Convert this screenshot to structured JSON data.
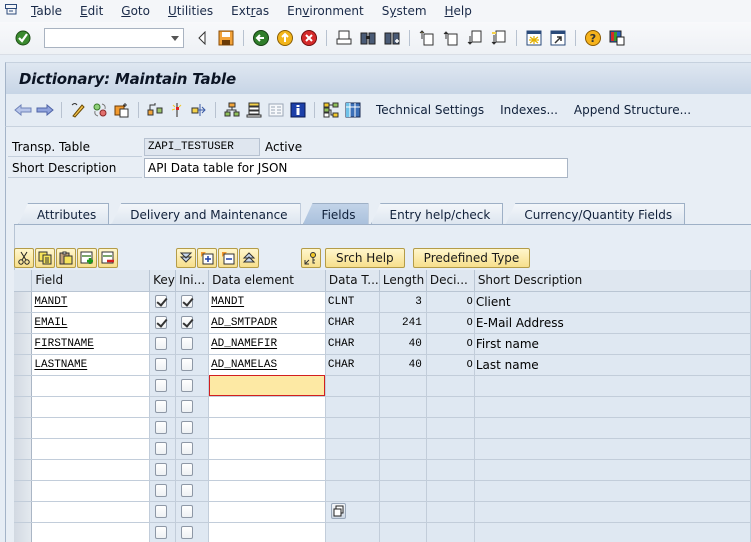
{
  "menubar": {
    "system_icon": "system-menu-icon",
    "items": [
      {
        "label": "Table",
        "mnemonic_index": 0
      },
      {
        "label": "Edit",
        "mnemonic_index": 0
      },
      {
        "label": "Goto",
        "mnemonic_index": 0
      },
      {
        "label": "Utilities",
        "mnemonic_index": 0
      },
      {
        "label": "Extras",
        "mnemonic_index": 3
      },
      {
        "label": "Environment",
        "mnemonic_index": 2
      },
      {
        "label": "System",
        "mnemonic_index": 1
      },
      {
        "label": "Help",
        "mnemonic_index": 0
      }
    ]
  },
  "standard_toolbar": {
    "command_field": {
      "value": "",
      "placeholder": ""
    },
    "icons": [
      "enter-icon",
      "back-arrow-icon",
      "save-icon",
      "back-icon",
      "exit-icon",
      "cancel-icon",
      "print-icon",
      "find-icon",
      "find-next-icon",
      "first-page-icon",
      "previous-page-icon",
      "next-page-icon",
      "last-page-icon",
      "new-session-icon",
      "shortcut-icon",
      "help-icon",
      "layout-menu-icon"
    ]
  },
  "title": "Dictionary: Maintain Table",
  "app_toolbar": {
    "icons": [
      "back-arrow-icon",
      "forward-arrow-icon",
      "display-change-icon",
      "other-object-icon",
      "activate-icon",
      "where-used-icon",
      "object-list-icon",
      "navigation-window-icon",
      "hierarchy-icon",
      "worklist-icon",
      "documentation-icon",
      "info-icon",
      "structure-graphic-icon",
      "table-icon"
    ],
    "buttons": [
      "Technical Settings",
      "Indexes...",
      "Append Structure..."
    ]
  },
  "header": {
    "table_label": "Transp. Table",
    "table_value": "ZAPI_TESTUSER",
    "status": "Active",
    "desc_label": "Short Description",
    "desc_value": "API Data table for JSON"
  },
  "tabs": [
    {
      "label": "Attributes",
      "active": false
    },
    {
      "label": "Delivery and Maintenance",
      "active": false
    },
    {
      "label": "Fields",
      "active": true
    },
    {
      "label": "Entry help/check",
      "active": false
    },
    {
      "label": "Currency/Quantity Fields",
      "active": false
    }
  ],
  "table_toolbar": {
    "edit_icons": [
      "cut-icon",
      "copy-icon",
      "paste-icon",
      "insert-row-icon",
      "delete-row-icon"
    ],
    "expand_icons": [
      "collapse-all-icon",
      "expand-icon",
      "collapse-icon",
      "expand-all-icon"
    ],
    "key_icon": "search-help-key-icon",
    "srch_help": "Srch Help",
    "predefined_type": "Predefined Type"
  },
  "grid": {
    "columns": [
      "Field",
      "Key",
      "Ini...",
      "Data element",
      "Data T...",
      "Length",
      "Deci...",
      "Short Description"
    ],
    "rows": [
      {
        "field": "MANDT",
        "key": true,
        "init": true,
        "data_element": "MANDT",
        "data_type": "CLNT",
        "length": "3",
        "decimals": "0",
        "description": "Client"
      },
      {
        "field": "EMAIL",
        "key": true,
        "init": true,
        "data_element": "AD_SMTPADR",
        "data_type": "CHAR",
        "length": "241",
        "decimals": "0",
        "description": "E-Mail Address"
      },
      {
        "field": "FIRSTNAME",
        "key": false,
        "init": false,
        "data_element": "AD_NAMEFIR",
        "data_type": "CHAR",
        "length": "40",
        "decimals": "0",
        "description": "First name"
      },
      {
        "field": "LASTNAME",
        "key": false,
        "init": false,
        "data_element": "AD_NAMELAS",
        "data_type": "CHAR",
        "length": "40",
        "decimals": "0",
        "description": "Last name"
      }
    ],
    "empty_rows": 8
  },
  "colors": {
    "focus_field": "#fde9a4",
    "focus_border": "#d21f1f",
    "button_yellow": "#f7df8c"
  }
}
